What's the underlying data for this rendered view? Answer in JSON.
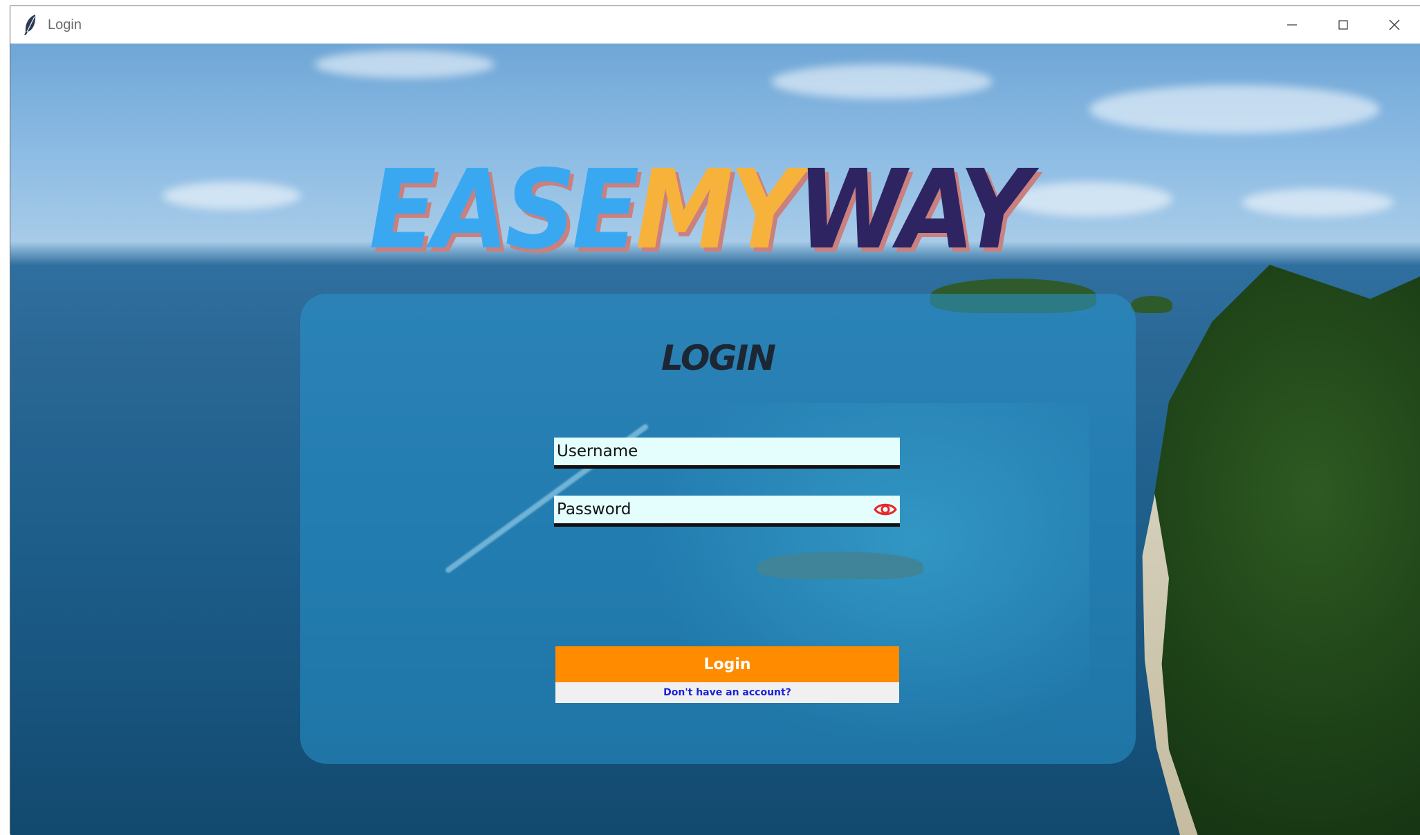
{
  "window": {
    "title": "Login",
    "controls": {
      "minimize_icon": "minimize-icon",
      "maximize_icon": "maximize-icon",
      "close_icon": "close-icon"
    }
  },
  "logo": {
    "part1": "EASE",
    "part2": "MY",
    "part3": "WAY",
    "colors": {
      "part1": "#3aa8f0",
      "part2": "#f7b23c",
      "part3": "#2e2462",
      "shadow": "#c9807e"
    }
  },
  "form": {
    "title": "LOGIN",
    "username": {
      "placeholder": "Username",
      "value": ""
    },
    "password": {
      "placeholder": "Password",
      "value": "",
      "toggle_icon": "eye-icon"
    },
    "login_button": "Login",
    "signup_link": "Don't have an account?"
  },
  "colors": {
    "accent": "#ff8c00",
    "field_bg": "#e4fdfd",
    "link": "#1a22d8",
    "eye": "#e8272b"
  }
}
